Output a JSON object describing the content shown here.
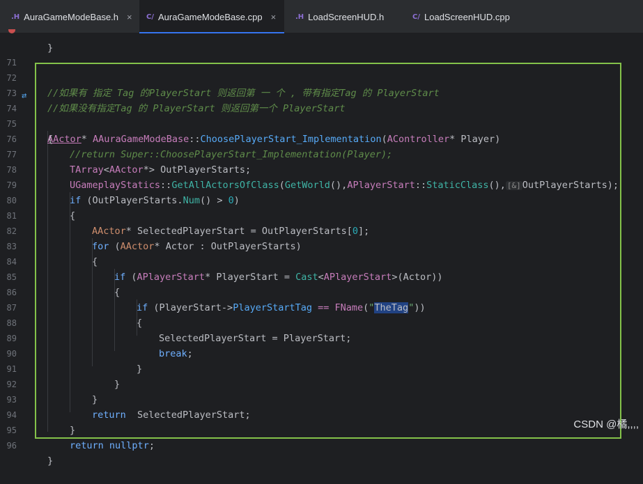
{
  "tabs": [
    {
      "icon": ".H",
      "label": "AuraGameModeBase.h",
      "close": "×",
      "active": false
    },
    {
      "icon": "C/",
      "label": "AuraGameModeBase.cpp",
      "close": "×",
      "active": true
    },
    {
      "icon": ".H",
      "label": "LoadScreenHUD.h",
      "close": "",
      "active": false
    },
    {
      "icon": "C/",
      "label": "LoadScreenHUD.cpp",
      "close": "",
      "active": false
    }
  ],
  "line_numbers": [
    "71",
    "72",
    "73",
    "74",
    "75",
    "76",
    "77",
    "78",
    "79",
    "80",
    "81",
    "82",
    "83",
    "84",
    "85",
    "86",
    "87",
    "88",
    "89",
    "90",
    "91",
    "92",
    "93",
    "94",
    "95",
    "96"
  ],
  "code": {
    "l70": "}",
    "l72": "//如果有 指定 Tag 的PlayerStart 则返回第 一 个 , 带有指定Tag 的 PlayerStart",
    "l73": "//如果没有指定Tag 的 PlayerStart 则返回第一个 PlayerStart",
    "l74_a": "AActor",
    "l74_b": "* ",
    "l74_c": "AAuraGameModeBase",
    "l74_d": "::",
    "l74_e": "ChoosePlayerStart_Implementation",
    "l74_f": "(",
    "l74_g": "AController",
    "l74_h": "* Player)",
    "l75": "{",
    "l76": "//return Super::ChoosePlayerStart_Implementation(Player);",
    "l77_a": "TArray",
    "l77_b": "<",
    "l77_c": "AActor",
    "l77_d": "*> OutPlayerStarts;",
    "l78_a": "UGameplayStatics",
    "l78_b": "::",
    "l78_c": "GetAllActorsOfClass",
    "l78_d": "(",
    "l78_e": "GetWorld",
    "l78_f": "(),",
    "l78_g": "APlayerStart",
    "l78_h": "::",
    "l78_i": "StaticClass",
    "l78_j": "(),",
    "l78_hint": "[&]",
    "l78_k": "OutPlayerStarts);",
    "l79_a": "if",
    "l79_b": " (OutPlayerStarts.",
    "l79_c": "Num",
    "l79_d": "() > ",
    "l79_e": "0",
    "l79_f": ")",
    "l80": "{",
    "l81_a": "AActor",
    "l81_b": "* SelectedPlayerStart = OutPlayerStarts[",
    "l81_c": "0",
    "l81_d": "];",
    "l82_a": "for",
    "l82_b": " (",
    "l82_c": "AActor",
    "l82_d": "* Actor : OutPlayerStarts)",
    "l83": "{",
    "l84_a": "if",
    "l84_b": " (",
    "l84_c": "APlayerStart",
    "l84_d": "* PlayerStart = ",
    "l84_e": "Cast",
    "l84_f": "<",
    "l84_g": "APlayerStart",
    "l84_h": ">(Actor))",
    "l85": "{",
    "l86_a": "if",
    "l86_b": " (PlayerStart->",
    "l86_c": "PlayerStartTag",
    "l86_d": " == ",
    "l86_e": "FName",
    "l86_f": "(",
    "l86_g": "\"",
    "l86_h": "TheTag",
    "l86_i": "\"",
    "l86_j": "))",
    "l87": "{",
    "l88": "SelectedPlayerStart = PlayerStart;",
    "l89_a": "break",
    "l89_b": ";",
    "l90": "}",
    "l91": "}",
    "l92": "}",
    "l93_a": "return",
    "l93_b": "  SelectedPlayerStart;",
    "l94": "}",
    "l95_a": "return",
    "l95_b": " ",
    "l95_c": "nullptr",
    "l95_d": ";",
    "l96": "}"
  },
  "implementation_icon": "⇄",
  "watermark": "CSDN @橘,,,,",
  "colors": {
    "highlight_border": "#84c24a",
    "tab_accent": "#3574f0"
  }
}
